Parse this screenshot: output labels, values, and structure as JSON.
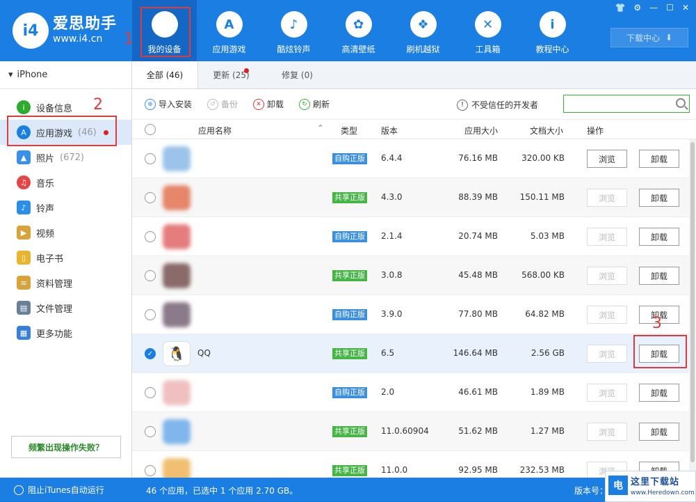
{
  "brand": {
    "logo": "i4",
    "name": "爱思助手",
    "url": "www.i4.cn"
  },
  "nav": [
    {
      "label": "我的设备",
      "icon": "apple-icon",
      "glyph": ""
    },
    {
      "label": "应用游戏",
      "icon": "app-store-icon",
      "glyph": "A"
    },
    {
      "label": "酷炫铃声",
      "icon": "bell-icon",
      "glyph": "♪"
    },
    {
      "label": "高清壁纸",
      "icon": "flower-icon",
      "glyph": "✿"
    },
    {
      "label": "刷机越狱",
      "icon": "dropbox-icon",
      "glyph": "❖"
    },
    {
      "label": "工具箱",
      "icon": "tools-icon",
      "glyph": "✕"
    },
    {
      "label": "教程中心",
      "icon": "info-icon",
      "glyph": "i"
    }
  ],
  "window_controls": [
    "👕",
    "⚙",
    "—",
    "☐",
    "✕"
  ],
  "download_center": "下载中心",
  "annotations": {
    "n1": "1",
    "n2": "2",
    "n3": "3"
  },
  "sidebar": {
    "device": "iPhone",
    "items": [
      {
        "label": "设备信息",
        "count": "",
        "icon": "info-icon",
        "color": "#2eaa2e",
        "glyph": "i"
      },
      {
        "label": "应用游戏",
        "count": "(46)",
        "icon": "app-store-icon",
        "color": "#1b7ee2",
        "glyph": "A"
      },
      {
        "label": "照片",
        "count": "(672)",
        "icon": "photo-icon",
        "color": "#3a8fe6",
        "glyph": "▲"
      },
      {
        "label": "音乐",
        "count": "",
        "icon": "music-icon",
        "color": "#e64545",
        "glyph": "♫"
      },
      {
        "label": "铃声",
        "count": "",
        "icon": "bell-icon",
        "color": "#2d8ee6",
        "glyph": "♪"
      },
      {
        "label": "视频",
        "count": "",
        "icon": "video-icon",
        "color": "#d9a33c",
        "glyph": "▶"
      },
      {
        "label": "电子书",
        "count": "",
        "icon": "book-icon",
        "color": "#e8b530",
        "glyph": "▯"
      },
      {
        "label": "资料管理",
        "count": "",
        "icon": "contacts-icon",
        "color": "#d9a33c",
        "glyph": "≡"
      },
      {
        "label": "文件管理",
        "count": "",
        "icon": "file-icon",
        "color": "#6a7f99",
        "glyph": "▤"
      },
      {
        "label": "更多功能",
        "count": "",
        "icon": "grid-icon",
        "color": "#3a7fd6",
        "glyph": "▦"
      }
    ],
    "fail_button": "频繁出现操作失败？"
  },
  "tabs": [
    {
      "label": "全部 (46)"
    },
    {
      "label": "更新 (25)"
    },
    {
      "label": "修复 (0)"
    }
  ],
  "toolbar": {
    "import": "导入安装",
    "backup": "备份",
    "uninstall": "卸载",
    "refresh": "刷新",
    "trust": "不受信任的开发者",
    "search_placeholder": ""
  },
  "table": {
    "headers": {
      "name": "应用名称",
      "type": "类型",
      "version": "版本",
      "size": "应用大小",
      "docsize": "文档大小",
      "action": "操作"
    },
    "rows": [
      {
        "name": "",
        "type": "自购正版",
        "type_kind": "buy",
        "version": "6.4.4",
        "size": "76.16 MB",
        "docsize": "320.00 KB",
        "browse_enabled": true,
        "icon_color": "#9cc3ea"
      },
      {
        "name": "",
        "type": "共享正版",
        "type_kind": "share",
        "version": "4.3.0",
        "size": "88.39 MB",
        "docsize": "150.11 MB",
        "browse_enabled": false,
        "icon_color": "#e5866a"
      },
      {
        "name": "",
        "type": "自购正版",
        "type_kind": "buy",
        "version": "2.1.4",
        "size": "20.74 MB",
        "docsize": "5.03 MB",
        "browse_enabled": false,
        "icon_color": "#e57d7d"
      },
      {
        "name": "",
        "type": "共享正版",
        "type_kind": "share",
        "version": "3.0.8",
        "size": "45.48 MB",
        "docsize": "568.00 KB",
        "browse_enabled": false,
        "icon_color": "#8a6a6a"
      },
      {
        "name": "",
        "type": "自购正版",
        "type_kind": "buy",
        "version": "3.9.0",
        "size": "77.80 MB",
        "docsize": "64.82 MB",
        "browse_enabled": false,
        "icon_color": "#8a7a8a"
      },
      {
        "name": "QQ",
        "type": "共享正版",
        "type_kind": "share",
        "version": "6.5",
        "size": "146.64 MB",
        "docsize": "2.56 GB",
        "browse_enabled": false,
        "icon_color": "#ffffff",
        "selected": true
      },
      {
        "name": "",
        "type": "自购正版",
        "type_kind": "buy",
        "version": "2.0",
        "size": "46.61 MB",
        "docsize": "1.89 MB",
        "browse_enabled": false,
        "icon_color": "#f0c0c0"
      },
      {
        "name": "",
        "type": "共享正版",
        "type_kind": "share",
        "version": "11.0.60904",
        "size": "51.62 MB",
        "docsize": "1.27 MB",
        "browse_enabled": false,
        "icon_color": "#7fb6ec"
      },
      {
        "name": "",
        "type": "共享正版",
        "type_kind": "share",
        "version": "11.0.0",
        "size": "92.95 MB",
        "docsize": "232.53 MB",
        "browse_enabled": false,
        "icon_color": "#f0c070"
      }
    ],
    "browse_label": "浏览",
    "uninstall_label": "卸载"
  },
  "footer": {
    "itunes": "阻止iTunes自动运行",
    "status": "46 个应用，已选中 1 个应用 2.70 GB。",
    "version_label": "版本号："
  },
  "watermark": {
    "logo": "电",
    "title": "这里下载站",
    "url": "www.Heredown.com"
  }
}
